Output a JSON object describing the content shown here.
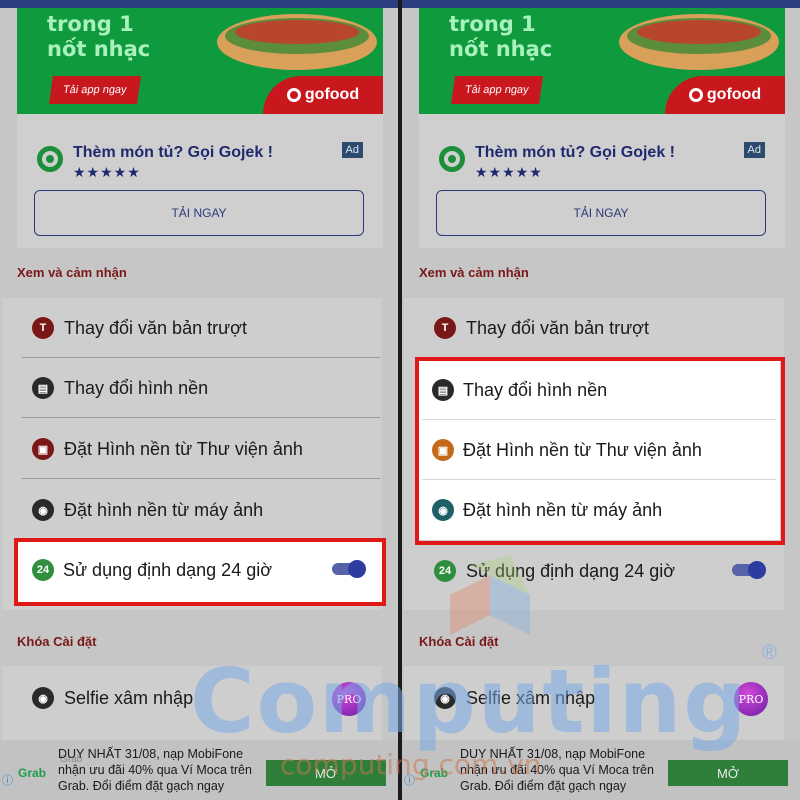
{
  "banner": {
    "text_line1": "trong 1",
    "text_line2": "nốt nhạc",
    "cta": "Tải app ngay",
    "brand": "gofood"
  },
  "ad": {
    "title": "Thèm món tủ? Gọi Gojek !",
    "stars": "★★★★★",
    "badge": "Ad",
    "button": "TẢI NGAY"
  },
  "sections": {
    "view": "Xem và cảm nhận",
    "lock": "Khóa Cài đặt"
  },
  "items": {
    "change_scroll_text": "Thay đổi văn bản trượt",
    "change_wallpaper": "Thay đổi hình nền",
    "wallpaper_from_gallery": "Đặt Hình nền từ Thư viện ảnh",
    "wallpaper_from_camera": "Đặt hình nền từ máy ảnh",
    "use_24h": "Sử dụng định dạng 24 giờ",
    "selfie_intrusion": "Selfie xâm nhập",
    "pro_badge": "PRO"
  },
  "toggle_24h": true,
  "bottom_ad": {
    "brand": "Grab",
    "brand_faint": "Grab",
    "text": "DUY NHẤT 31/08, nạp MobiFone nhận ưu đãi 40% qua Ví Moca trên Grab. Đổi điểm đặt gạch ngay",
    "button": "MỞ",
    "info": "ⓘ"
  },
  "watermark": {
    "main": "Computing",
    "sub": "computing.com.vn",
    "reg": "®"
  },
  "icons": {
    "scroll_text": "text-scroll-icon",
    "wallpaper": "image-icon",
    "gallery": "gallery-icon",
    "camera": "camera-icon",
    "clock24": "clock-24-icon"
  },
  "colors": {
    "highlight_border": "#e01818",
    "section_title": "#7a1717",
    "toggle": "#2c3ca0",
    "banner_green": "#0f9a3d"
  }
}
